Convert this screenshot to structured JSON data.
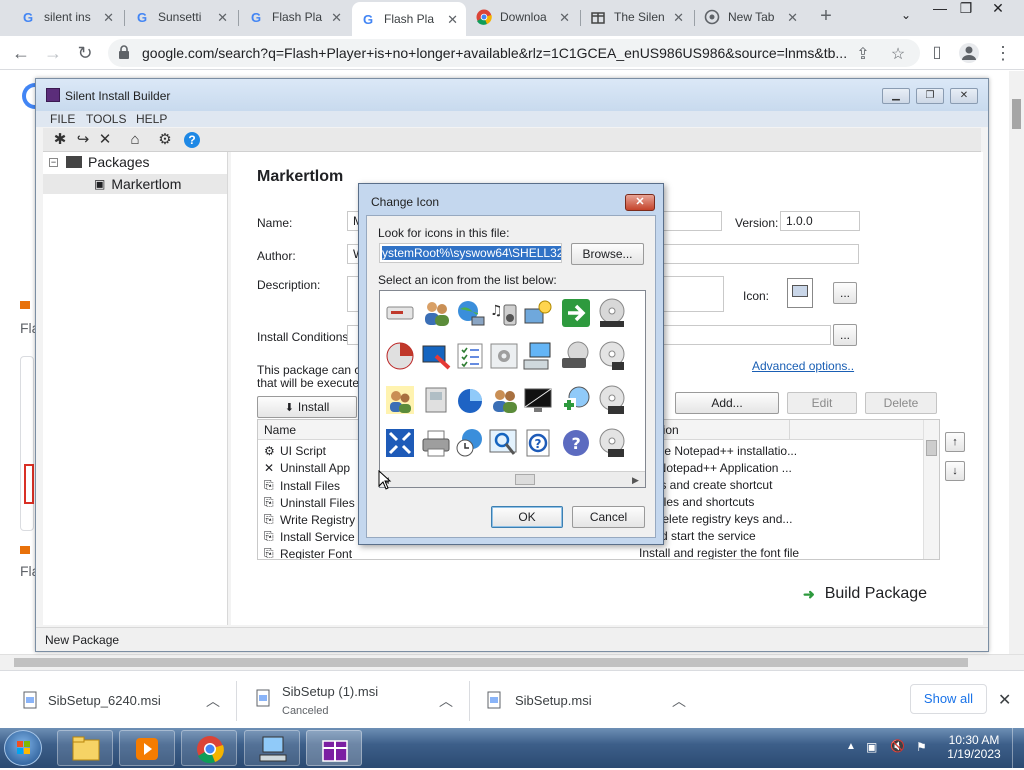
{
  "browser": {
    "tabs": [
      {
        "title": "silent ins",
        "favicon": "G",
        "favicon_color": "#4285f4"
      },
      {
        "title": "Sunsetti",
        "favicon": "G",
        "favicon_color": "#4285f4"
      },
      {
        "title": "Flash Pla",
        "favicon": "G",
        "favicon_color": "#4285f4"
      },
      {
        "title": "Flash Pla",
        "favicon": "G",
        "favicon_color": "#4285f4",
        "active": true
      },
      {
        "title": "Downloa",
        "favicon": "chrome-icon"
      },
      {
        "title": "The Silen",
        "favicon": "sib-icon"
      },
      {
        "title": "New Tab",
        "favicon": "globe-icon"
      }
    ],
    "new_tab_symbol": "+",
    "url": "google.com/search?q=Flash+Player+is+no+longer+available&rlz=1C1GCEA_enUS986US986&source=lnms&tb..."
  },
  "google_page": {
    "left_fragments": [
      "Fla",
      "Fla"
    ]
  },
  "sib": {
    "title": "Silent Install Builder",
    "menu": [
      "FILE",
      "TOOLS",
      "HELP"
    ],
    "tree": {
      "root": "Packages",
      "child": "Markertlom"
    },
    "package": {
      "heading": "Markertlom",
      "name_label": "Name:",
      "name_value": "M",
      "version_label": "Version:",
      "version_value": "1.0.0",
      "author_label": "Author:",
      "author_value": "W",
      "description_label": "Description:",
      "icon_label": "Icon:",
      "browse_small": "...",
      "install_conditions_label": "Install Conditions:",
      "info_line1": "This package can con",
      "info_line2": "that will be executed",
      "advanced_options": "Advanced options..",
      "install_tab": "Install",
      "add_button": "Add...",
      "edit_button": "Edit",
      "delete_button": "Delete",
      "col_name": "Name",
      "col_description": "ription",
      "rows": [
        {
          "name": "UI Script",
          "icon": "script-icon",
          "desc": "omise Notepad++ installatio..."
        },
        {
          "name": "Uninstall App",
          "icon": "x-icon",
          "desc": "tall Notepad++ Application ..."
        },
        {
          "name": "Install Files",
          "icon": "file-icon",
          "desc": "l files and create shortcut"
        },
        {
          "name": "Uninstall Files",
          "icon": "file-icon",
          "desc": "tall files and shortcuts"
        },
        {
          "name": "Write Registry",
          "icon": "file-icon",
          "desc": "e / delete registry keys and..."
        },
        {
          "name": "Install Service",
          "icon": "file-icon",
          "desc": "ll and start the service"
        },
        {
          "name": "Register Font",
          "icon": "file-icon",
          "desc": "Install and register the font file"
        }
      ],
      "build_button": "Build Package"
    },
    "status": "New Package"
  },
  "dialog": {
    "title": "Change Icon",
    "look_label": "Look for icons in this file:",
    "file_value": "ystemRoot%\\syswow64\\SHELL32.dll",
    "browse_button": "Browse...",
    "select_label": "Select an icon from the list below:",
    "ok_button": "OK",
    "cancel_button": "Cancel",
    "close_symbol": "✕"
  },
  "downloads": [
    {
      "name": "SibSetup_6240.msi",
      "sub": ""
    },
    {
      "name": "SibSetup (1).msi",
      "sub": "Canceled"
    },
    {
      "name": "SibSetup.msi",
      "sub": ""
    }
  ],
  "show_all": "Show all",
  "taskbar": {
    "time": "10:30 AM",
    "date": "1/19/2023"
  }
}
